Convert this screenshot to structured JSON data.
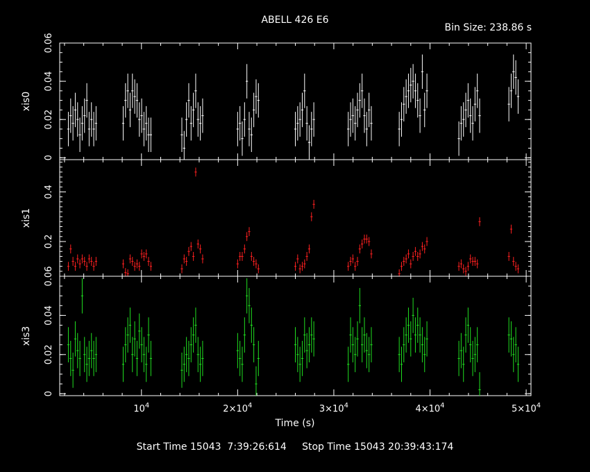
{
  "chart_data": {
    "type": "scatter",
    "title": "ABELL 426 E6",
    "bin_size_label": "Bin Size: 238.86 s",
    "xlabel": "Time (s)",
    "xlim": [
      1500,
      50500
    ],
    "x_ticks": [
      {
        "value": 10000,
        "mant": "",
        "exp": "4"
      },
      {
        "value": 20000,
        "mant": "2×",
        "exp": "4"
      },
      {
        "value": 30000,
        "mant": "3×",
        "exp": "4"
      },
      {
        "value": 40000,
        "mant": "4×",
        "exp": "4"
      },
      {
        "value": 50000,
        "mant": "5×",
        "exp": "4"
      }
    ],
    "panels": [
      {
        "name": "xis0",
        "color": "#ffffff",
        "ylim": [
          -0.001,
          0.06
        ],
        "yticks": [
          {
            "v": 0,
            "t": "0"
          },
          {
            "v": 0.02,
            "t": "0.02"
          },
          {
            "v": 0.04,
            "t": "0.04"
          },
          {
            "v": 0.06,
            "t": "0.06"
          }
        ],
        "yerr": 0.009,
        "x": [
          2400,
          2640,
          2880,
          3120,
          3360,
          3600,
          3840,
          4080,
          4320,
          4560,
          4800,
          5040,
          5280,
          8100,
          8340,
          8580,
          8820,
          9060,
          9300,
          9540,
          9780,
          10020,
          10260,
          10500,
          10740,
          10980,
          14200,
          14440,
          14680,
          14920,
          15160,
          15400,
          15640,
          15880,
          16120,
          16360,
          20000,
          20240,
          20480,
          20720,
          20960,
          21200,
          21440,
          21680,
          21920,
          22160,
          26000,
          26240,
          26480,
          26720,
          26960,
          27200,
          27440,
          27680,
          27920,
          31500,
          31740,
          31980,
          32220,
          32460,
          32700,
          32940,
          33180,
          33420,
          33660,
          33900,
          36800,
          37040,
          37280,
          37520,
          37760,
          38000,
          38240,
          38480,
          38720,
          38960,
          39200,
          39440,
          39680,
          43000,
          43240,
          43480,
          43720,
          43960,
          44200,
          44440,
          44680,
          44920,
          45160,
          48200,
          48440,
          48680,
          48920,
          49160
        ],
        "y": [
          0.015,
          0.022,
          0.018,
          0.025,
          0.02,
          0.012,
          0.018,
          0.022,
          0.03,
          0.015,
          0.02,
          0.015,
          0.018,
          0.018,
          0.03,
          0.035,
          0.025,
          0.035,
          0.032,
          0.03,
          0.02,
          0.022,
          0.015,
          0.018,
          0.012,
          0.012,
          0.012,
          0.005,
          0.02,
          0.03,
          0.018,
          0.025,
          0.035,
          0.02,
          0.018,
          0.022,
          0.015,
          0.018,
          0.01,
          0.02,
          0.04,
          0.015,
          0.012,
          0.025,
          0.032,
          0.03,
          0.015,
          0.018,
          0.02,
          0.025,
          0.035,
          0.018,
          0.008,
          0.015,
          0.02,
          0.015,
          0.02,
          0.022,
          0.018,
          0.025,
          0.03,
          0.035,
          0.022,
          0.015,
          0.025,
          0.018,
          0.015,
          0.02,
          0.028,
          0.032,
          0.035,
          0.038,
          0.04,
          0.035,
          0.03,
          0.022,
          0.045,
          0.025,
          0.035,
          0.01,
          0.018,
          0.02,
          0.025,
          0.03,
          0.022,
          0.018,
          0.028,
          0.035,
          0.022,
          0.028,
          0.035,
          0.045,
          0.042,
          0.032
        ]
      },
      {
        "name": "xis1",
        "color": "#ff2020",
        "ylim": [
          0.06,
          0.53
        ],
        "yticks": [
          {
            "v": 0.06,
            "t": "0.06"
          },
          {
            "v": 0.2,
            "t": "0.2"
          },
          {
            "v": 0.4,
            "t": "0.4"
          }
        ],
        "yerr": 0.018,
        "x": [
          2400,
          2640,
          2880,
          3120,
          3360,
          3600,
          3840,
          4080,
          4320,
          4560,
          4800,
          5040,
          5280,
          8100,
          8340,
          8580,
          8820,
          9060,
          9300,
          9540,
          9780,
          10020,
          10260,
          10500,
          10740,
          10980,
          14200,
          14440,
          14680,
          14920,
          15160,
          15400,
          15640,
          15880,
          16120,
          16360,
          20000,
          20240,
          20480,
          20720,
          20960,
          21200,
          21440,
          21680,
          21920,
          22160,
          26000,
          26240,
          26480,
          26720,
          26960,
          27200,
          27440,
          27680,
          27920,
          31500,
          31740,
          31980,
          32220,
          32460,
          32700,
          32940,
          33180,
          33420,
          33660,
          33900,
          36800,
          37040,
          37280,
          37520,
          37760,
          38000,
          38240,
          38480,
          38720,
          38960,
          39200,
          39440,
          39680,
          43000,
          43240,
          43480,
          43720,
          43960,
          44200,
          44440,
          44680,
          44920,
          45160,
          48200,
          48440,
          48680,
          48920,
          49160
        ],
        "y": [
          0.1,
          0.17,
          0.12,
          0.1,
          0.13,
          0.11,
          0.13,
          0.12,
          0.1,
          0.13,
          0.12,
          0.1,
          0.12,
          0.11,
          0.075,
          0.07,
          0.13,
          0.12,
          0.1,
          0.11,
          0.1,
          0.15,
          0.14,
          0.15,
          0.12,
          0.1,
          0.09,
          0.13,
          0.12,
          0.16,
          0.18,
          0.14,
          0.48,
          0.19,
          0.17,
          0.13,
          0.11,
          0.14,
          0.14,
          0.17,
          0.22,
          0.24,
          0.14,
          0.12,
          0.11,
          0.09,
          0.1,
          0.13,
          0.09,
          0.1,
          0.11,
          0.14,
          0.17,
          0.3,
          0.35,
          0.1,
          0.12,
          0.13,
          0.1,
          0.12,
          0.17,
          0.19,
          0.21,
          0.21,
          0.2,
          0.15,
          0.07,
          0.1,
          0.12,
          0.13,
          0.15,
          0.11,
          0.14,
          0.16,
          0.14,
          0.15,
          0.18,
          0.17,
          0.2,
          0.1,
          0.11,
          0.09,
          0.08,
          0.1,
          0.13,
          0.12,
          0.12,
          0.11,
          0.28,
          0.14,
          0.25,
          0.12,
          0.1,
          0.09
        ]
      },
      {
        "name": "xis3",
        "color": "#20e020",
        "ylim": [
          -0.001,
          0.06
        ],
        "yticks": [
          {
            "v": 0,
            "t": "0"
          },
          {
            "v": 0.02,
            "t": "0.02"
          },
          {
            "v": 0.04,
            "t": "0.04"
          }
        ],
        "yerr": 0.009,
        "x": [
          2400,
          2640,
          2880,
          3120,
          3360,
          3600,
          3840,
          4080,
          4320,
          4560,
          4800,
          5040,
          5280,
          8100,
          8340,
          8580,
          8820,
          9060,
          9300,
          9540,
          9780,
          10020,
          10260,
          10500,
          10740,
          10980,
          14200,
          14440,
          14680,
          14920,
          15160,
          15400,
          15640,
          15880,
          16120,
          16360,
          20000,
          20240,
          20480,
          20720,
          20960,
          21200,
          21440,
          21680,
          21920,
          22160,
          26000,
          26240,
          26480,
          26720,
          26960,
          27200,
          27440,
          27680,
          27920,
          31500,
          31740,
          31980,
          32220,
          32460,
          32700,
          32940,
          33180,
          33420,
          33660,
          33900,
          36800,
          37040,
          37280,
          37520,
          37760,
          38000,
          38240,
          38480,
          38720,
          38960,
          39200,
          39440,
          39680,
          43000,
          43240,
          43480,
          43720,
          43960,
          44200,
          44440,
          44680,
          44920,
          45160,
          48200,
          48440,
          48680,
          48920,
          49160
        ],
        "y": [
          0.025,
          0.018,
          0.012,
          0.028,
          0.022,
          0.018,
          0.05,
          0.02,
          0.015,
          0.018,
          0.022,
          0.018,
          0.02,
          0.015,
          0.025,
          0.03,
          0.035,
          0.02,
          0.028,
          0.018,
          0.032,
          0.025,
          0.02,
          0.015,
          0.03,
          0.018,
          0.012,
          0.015,
          0.02,
          0.018,
          0.025,
          0.03,
          0.035,
          0.02,
          0.015,
          0.018,
          0.022,
          0.018,
          0.015,
          0.03,
          0.05,
          0.045,
          0.035,
          0.025,
          0.005,
          0.018,
          0.025,
          0.02,
          0.015,
          0.018,
          0.03,
          0.022,
          0.025,
          0.03,
          0.028,
          0.015,
          0.03,
          0.025,
          0.02,
          0.028,
          0.045,
          0.025,
          0.03,
          0.022,
          0.02,
          0.025,
          0.02,
          0.015,
          0.025,
          0.03,
          0.035,
          0.028,
          0.04,
          0.03,
          0.035,
          0.03,
          0.025,
          0.02,
          0.028,
          0.018,
          0.022,
          0.015,
          0.03,
          0.035,
          0.025,
          0.018,
          0.02,
          0.025,
          0.002,
          0.03,
          0.028,
          0.02,
          0.025,
          0.015
        ]
      }
    ],
    "footer": "Start Time 15043  7:39:26:614     Stop Time 15043 20:39:43:174"
  }
}
